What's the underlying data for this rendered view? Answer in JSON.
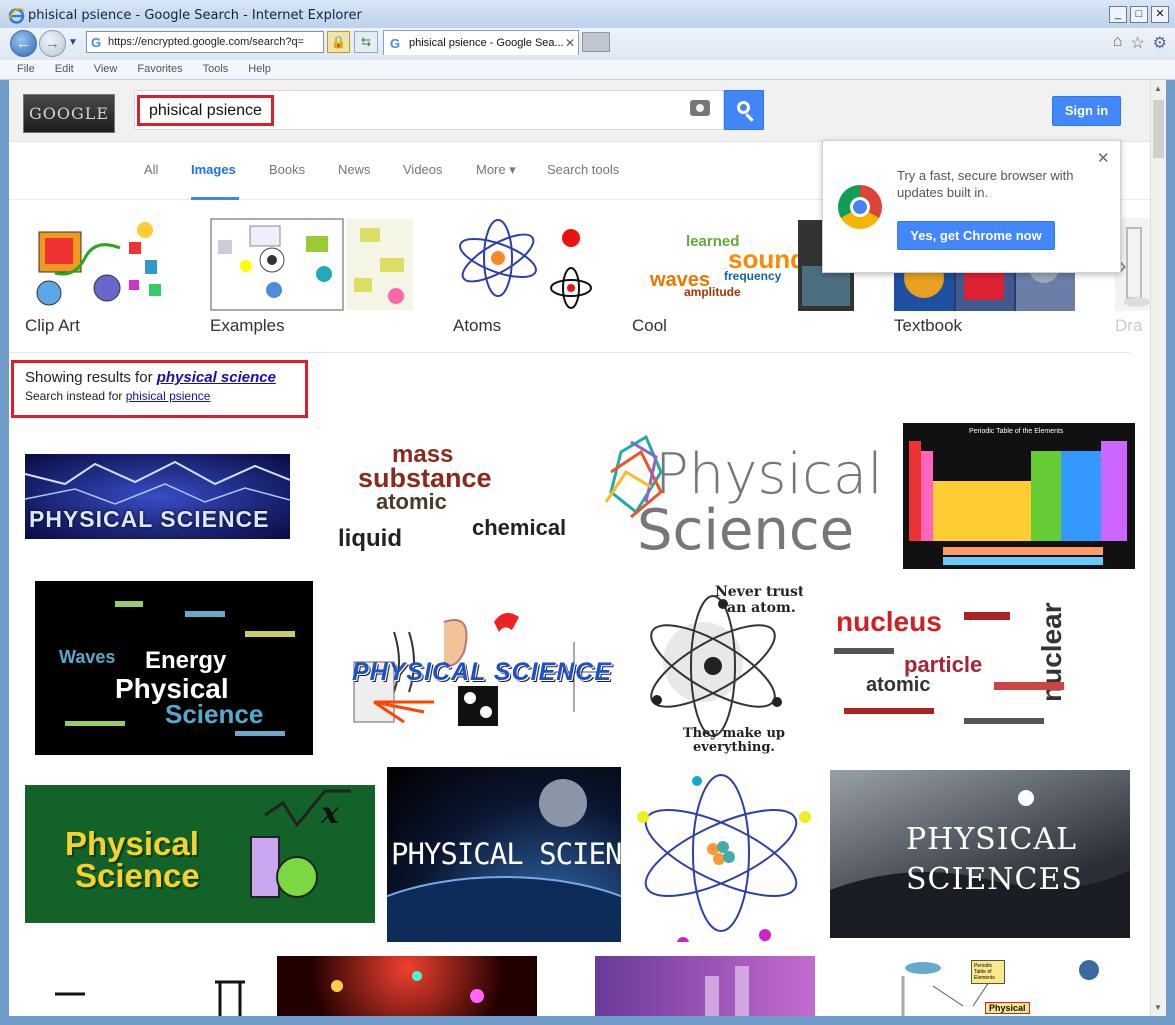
{
  "window": {
    "title": "phisical psience - Google Search - Internet Explorer",
    "controls": [
      "_",
      "□",
      "✕"
    ]
  },
  "browser": {
    "address": "https://encrypted.google.com/search?q=",
    "tab_label": "phisical psience - Google Sea...",
    "tab_close": "✕",
    "menu": [
      "File",
      "Edit",
      "View",
      "Favorites",
      "Tools",
      "Help"
    ]
  },
  "header": {
    "logo_text": "GOOGLE",
    "query": "phisical psience",
    "signin_label": "Sign in"
  },
  "tabs": [
    {
      "label": "All"
    },
    {
      "label": "Images"
    },
    {
      "label": "Books"
    },
    {
      "label": "News"
    },
    {
      "label": "Videos"
    },
    {
      "label": "More ▾"
    },
    {
      "label": "Search tools"
    }
  ],
  "related": [
    {
      "label": "Clip Art"
    },
    {
      "label": "Examples"
    },
    {
      "label": "Atoms"
    },
    {
      "label": "Cool"
    },
    {
      "label": "Textbook"
    },
    {
      "label": "Dra"
    }
  ],
  "did_you_mean": {
    "prefix": "Showing results for ",
    "corrected": "physical science",
    "instead_prefix": "Search instead for ",
    "original": "phisical psience"
  },
  "promo": {
    "text": "Try a fast, secure browser with updates built in.",
    "button": "Yes, get Chrome now",
    "close": "✕"
  },
  "tiles": {
    "t1": "PHYSICAL SCIENCE",
    "t2a": "substance",
    "t2b": "atomic",
    "t2c": "liquid",
    "t2d": "chemical",
    "t2e": "mass",
    "t3a": "Physical",
    "t3b": "Science",
    "t4": "Periodic Table of the Elements",
    "t5a": "Energy",
    "t5b": "Physical",
    "t5c": "Science",
    "t5d": "Waves",
    "t6": "PHYSICAL SCIENCE",
    "t7a": "Never trust",
    "t7b": "an atom.",
    "t7c": "They make up",
    "t7d": "everything.",
    "t8a": "nucleus",
    "t8b": "particle",
    "t8c": "atomic",
    "t8d": "nuclear",
    "t9a": "Physical",
    "t9b": "Science",
    "t10": "PHYSICAL SCIENCE",
    "t12a": "PHYSICAL",
    "t12b": "SCIENCES",
    "t16a": "Periodic Table of Elements",
    "t16b": "Physical"
  }
}
